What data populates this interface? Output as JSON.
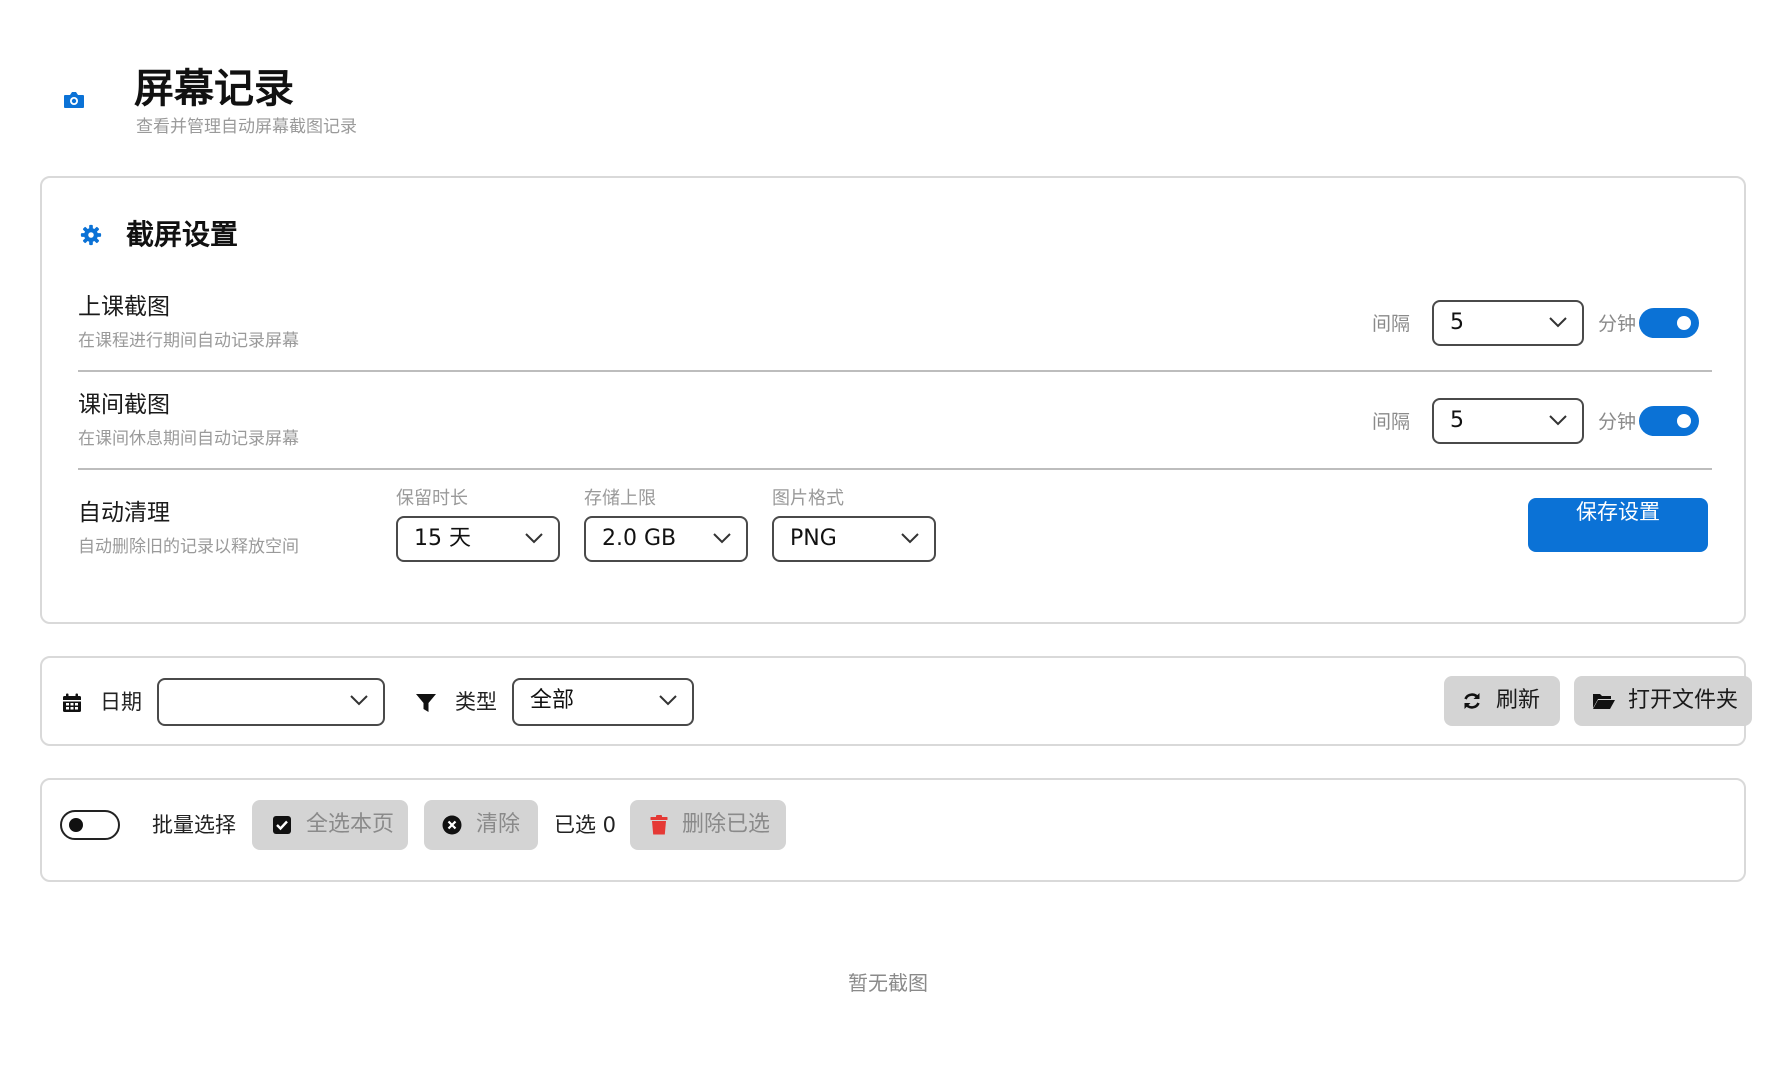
{
  "header": {
    "icon": "camera-icon",
    "title": "屏幕记录",
    "subtitle": "查看并管理自动屏幕截图记录"
  },
  "settings": {
    "title": "截屏设置",
    "icon": "gear-icon",
    "accent_color": "#0b72d6",
    "class_capture": {
      "label": "上课截图",
      "desc": "在课程进行期间自动记录屏幕",
      "interval_label": "间隔",
      "interval_value": "5",
      "unit": "分钟",
      "enabled": true
    },
    "break_capture": {
      "label": "课间截图",
      "desc": "在课间休息期间自动记录屏幕",
      "interval_label": "间隔",
      "interval_value": "5",
      "unit": "分钟",
      "enabled": true
    },
    "auto_clean": {
      "label": "自动清理",
      "desc": "自动删除旧的记录以释放空间",
      "retention_label": "保留时长",
      "retention_value": "15 天",
      "storage_label": "存储上限",
      "storage_value": "2.0 GB",
      "format_label": "图片格式",
      "format_value": "PNG"
    },
    "save_label": "保存设置"
  },
  "filters": {
    "date_icon": "calendar-icon",
    "date_label": "日期",
    "date_value": "",
    "type_icon": "filter-icon",
    "type_label": "类型",
    "type_value": "全部",
    "refresh_icon": "refresh-icon",
    "refresh_label": "刷新",
    "open_folder_icon": "folder-open-icon",
    "open_folder_label": "打开文件夹"
  },
  "batch": {
    "enabled": false,
    "label": "批量选择",
    "select_page_icon": "checkbox-icon",
    "select_page_label": "全选本页",
    "clear_icon": "close-circle-icon",
    "clear_label": "清除",
    "selected_text": "已选 0",
    "delete_icon": "trash-icon",
    "delete_label": "删除已选",
    "delete_color": "#e53935"
  },
  "empty_state": "暂无截图"
}
